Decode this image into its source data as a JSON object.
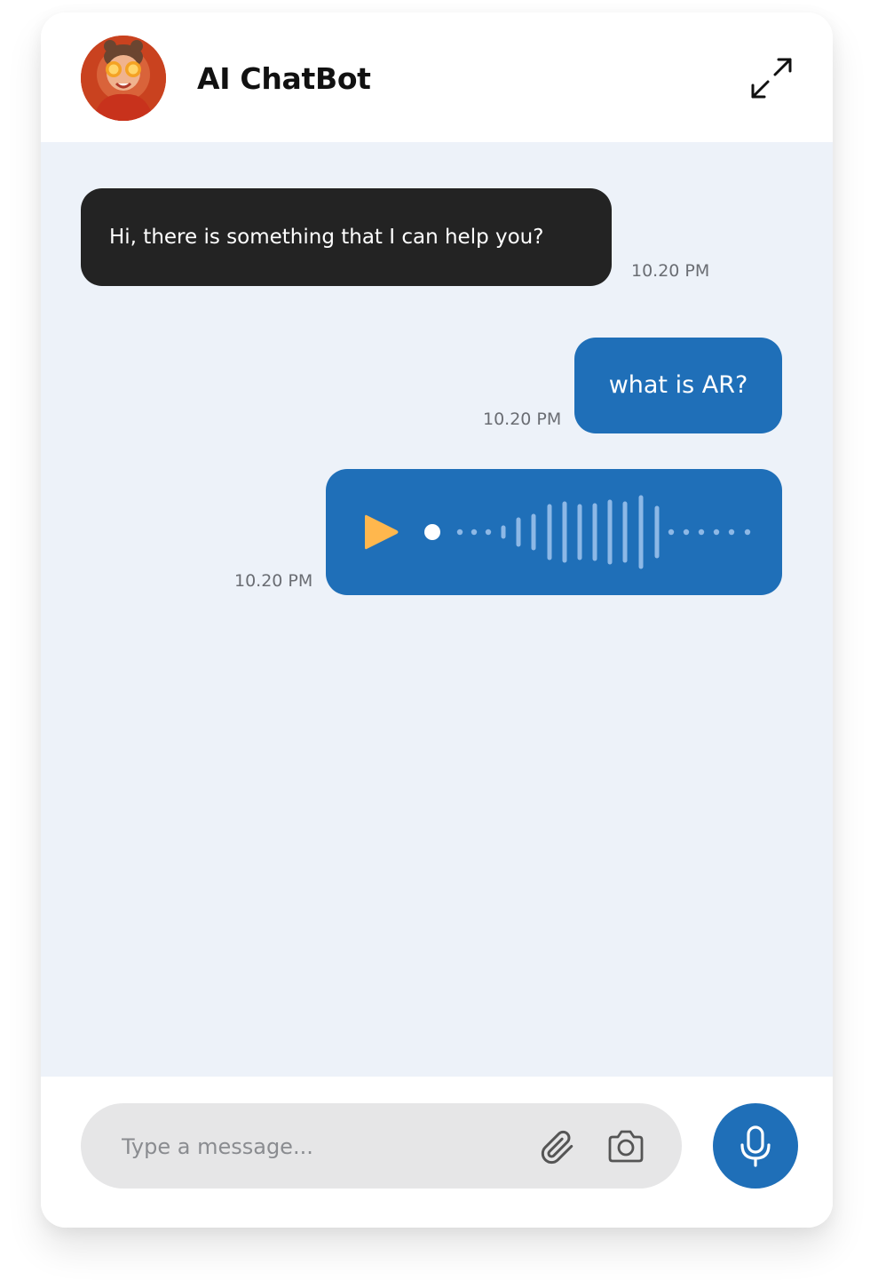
{
  "header": {
    "title": "AI ChatBot",
    "avatar_icon": "user-avatar-photo",
    "expand_icon": "expand-arrows-icon"
  },
  "messages": [
    {
      "sender": "bot",
      "type": "text",
      "text": "Hi, there is something that I can help you?",
      "time": "10.20 PM"
    },
    {
      "sender": "user",
      "type": "text",
      "text": "what is AR?",
      "time": "10.20 PM"
    },
    {
      "sender": "user",
      "type": "voice",
      "time": "10.20 PM",
      "play_icon": "play-icon",
      "waveform_icon": "audio-waveform-icon"
    }
  ],
  "composer": {
    "placeholder": "Type a message...",
    "attach_icon": "paperclip-icon",
    "camera_icon": "camera-icon",
    "mic_icon": "microphone-icon"
  },
  "colors": {
    "accent": "#1f6fb8",
    "bot_bubble": "#232323",
    "chat_background": "#edf2f9",
    "input_background": "#e6e6e7",
    "play_icon": "#ffb74d"
  }
}
